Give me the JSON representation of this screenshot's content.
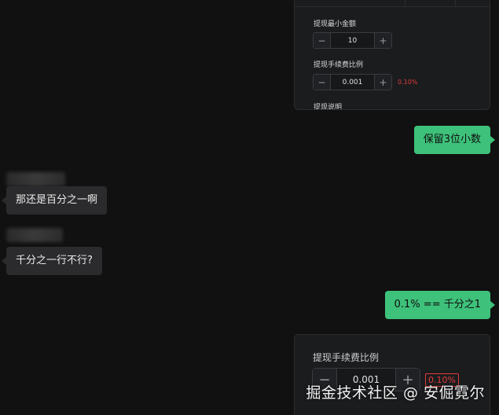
{
  "top_card": {
    "min_amount_label": "提现最小金额",
    "min_amount_value": "10",
    "fee_ratio_label": "提现手续费比例",
    "fee_ratio_value": "0.001",
    "fee_percent": "0.10%",
    "desc_label": "提现说明"
  },
  "messages": [
    {
      "side": "out",
      "text": "保留3位小数"
    },
    {
      "side": "in",
      "text": "那还是百分之一啊"
    },
    {
      "side": "in",
      "text": "千分之一行不行?"
    },
    {
      "side": "out",
      "text": "0.1% == 千分之1"
    }
  ],
  "bottom_card": {
    "fee_ratio_label": "提现手续费比例",
    "fee_ratio_value": "0.001",
    "fee_percent": "0.10%"
  },
  "stepper_icons": {
    "minus": "minus-icon",
    "plus": "plus-icon"
  },
  "watermark": "掘金技术社区 @ 安倔霓尔",
  "colors": {
    "background": "#111111",
    "outgoing_bubble": "#3ec17a",
    "incoming_bubble": "#2b2b2d",
    "percent_red": "#e23b3b"
  }
}
